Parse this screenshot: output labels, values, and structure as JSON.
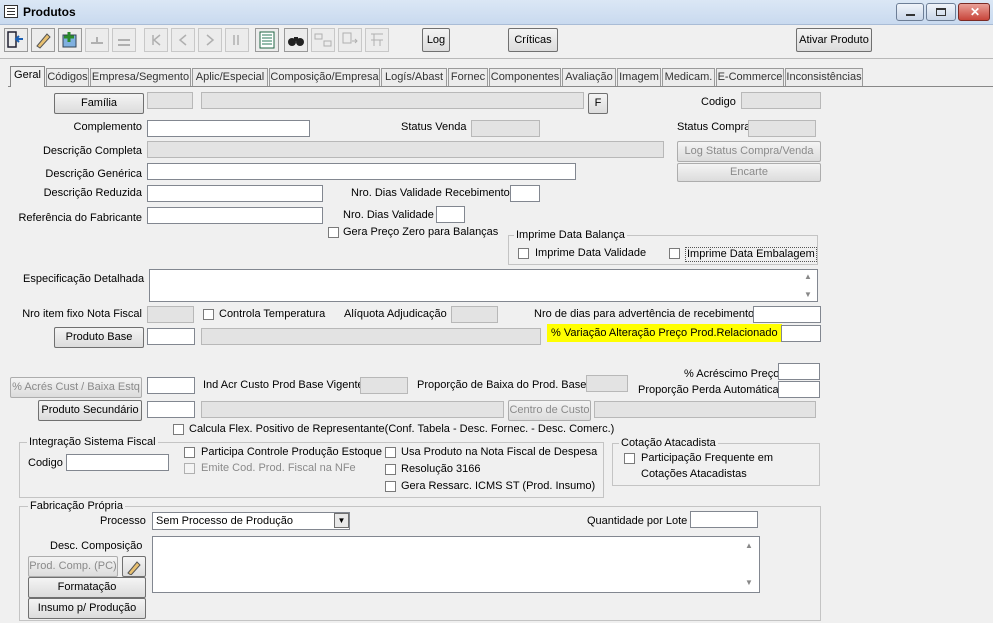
{
  "window": {
    "title": "Produtos"
  },
  "toolbar": {
    "log_label": "Log",
    "criticas_label": "Críticas",
    "ativar_label": "Ativar Produto"
  },
  "tabs": [
    "Geral",
    "Códigos",
    "Empresa/Segmento",
    "Aplic/Especial",
    "Composição/Empresa",
    "Logís/Abast",
    "Fornec",
    "Componentes",
    "Avaliação",
    "Imagem",
    "Medicam.",
    "E-Commerce",
    "Inconsistências"
  ],
  "form": {
    "familia_button": "Família",
    "f_button": "F",
    "codigo_label": "Codigo",
    "complemento_label": "Complemento",
    "status_venda_label": "Status Venda",
    "status_compra_label": "Status Compra",
    "descricao_completa_label": "Descrição Completa",
    "log_status_button": "Log Status Compra/Venda",
    "descricao_generica_label": "Descrição Genérica",
    "encarte_button": "Encarte",
    "descricao_reduzida_label": "Descrição Reduzida",
    "dias_validade_receb_label": "Nro. Dias Validade Recebimento",
    "referencia_fabricante_label": "Referência do Fabricante",
    "dias_validade_label": "Nro. Dias Validade",
    "gera_preco_zero_label": "Gera Preço Zero para Balanças",
    "imprime_data_balanca_group": "Imprime Data Balança",
    "imprime_data_validade_label": "Imprime Data Validade",
    "imprime_data_embalagem_label": "Imprime Data Embalagem",
    "especificacao_label": "Especificação Detalhada",
    "nro_item_nf_label": "Nro item fixo Nota Fiscal",
    "controla_temp_label": "Controla Temperatura",
    "aliquota_label": "Alíquota Adjudicação",
    "nro_dias_advert_label": "Nro de dias para advertência de recebimento",
    "produto_base_button": "Produto Base",
    "variacao_label": "% Variação Alteração Preço Prod.Relacionado",
    "acrescimo_preco_label": "% Acréscimo Preço",
    "acres_cust_button": "% Acrés Cust / Baixa Estq",
    "ind_acr_label": "Ind Acr Custo Prod Base Vigente",
    "proporcao_baixa_label": "Proporção de Baixa do Prod. Base",
    "proporcao_perda_label": "Proporção Perda Automática",
    "produto_secundario_button": "Produto Secundário",
    "centro_custo_button": "Centro de Custo",
    "calcula_flex_label": "Calcula Flex. Positivo de Representante(Conf. Tabela - Desc. Fornec. - Desc. Comerc.)"
  },
  "integracao": {
    "group": "Integração Sistema Fiscal",
    "codigo_label": "Codigo",
    "participa_label": "Participa Controle Produção Estoque",
    "emite_label": "Emite Cod. Prod. Fiscal na NFe",
    "usa_produto_label": "Usa Produto na Nota Fiscal de Despesa",
    "resolucao_label": "Resolução 3166",
    "gera_ressarc_label": "Gera Ressarc. ICMS ST (Prod. Insumo)"
  },
  "cotacao": {
    "group": "Cotação Atacadista",
    "participacao_label_1": "Participação Frequente em",
    "participacao_label_2": "Cotações Atacadistas"
  },
  "fabricacao": {
    "group": "Fabricação Própria",
    "processo_label": "Processo",
    "processo_value": "Sem Processo de Produção",
    "quantidade_lote_label": "Quantidade por Lote",
    "desc_composicao_label": "Desc. Composição",
    "prod_comp_button": "Prod. Comp. (PC)",
    "formatacao_button": "Formatação",
    "insumo_button": "Insumo p/ Produção"
  },
  "colors": {
    "highlight": "#ffff00",
    "titlebar": "#c9daef",
    "close_button": "#c8453a"
  }
}
